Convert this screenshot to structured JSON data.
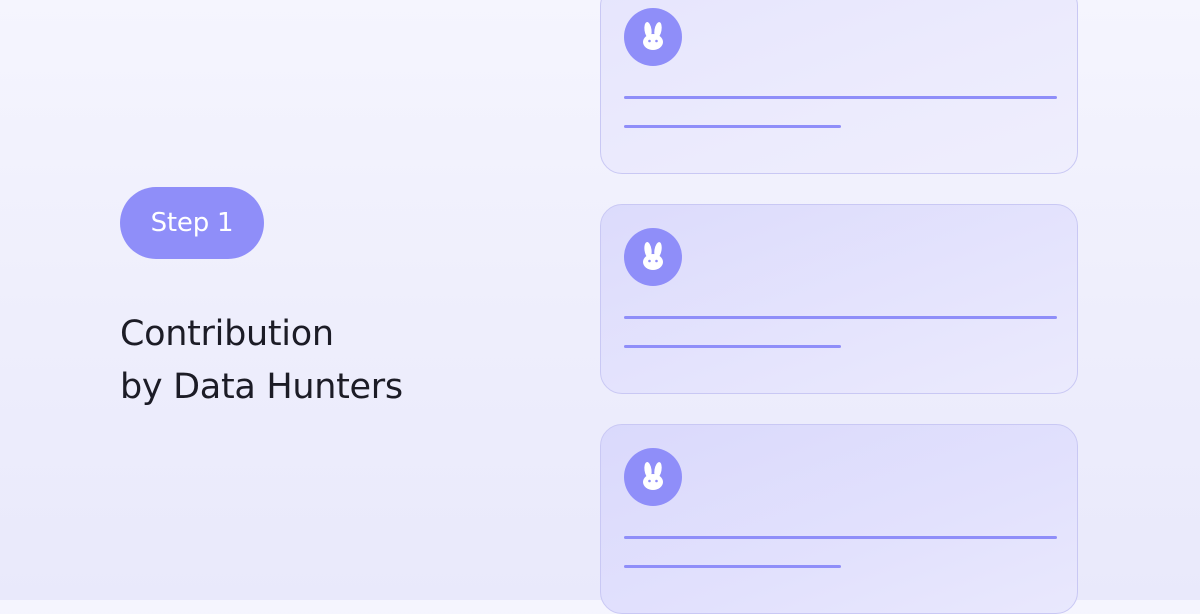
{
  "step": {
    "label": "Step 1"
  },
  "headline": {
    "line1": "Contribution",
    "line2": "by Data Hunters"
  },
  "cards": [
    {
      "avatar_icon": "bunny-icon"
    },
    {
      "avatar_icon": "bunny-icon"
    },
    {
      "avatar_icon": "bunny-icon"
    }
  ],
  "colors": {
    "accent": "#8f8ef9",
    "text": "#1c1c26",
    "card_border": "#c9c8f4"
  }
}
